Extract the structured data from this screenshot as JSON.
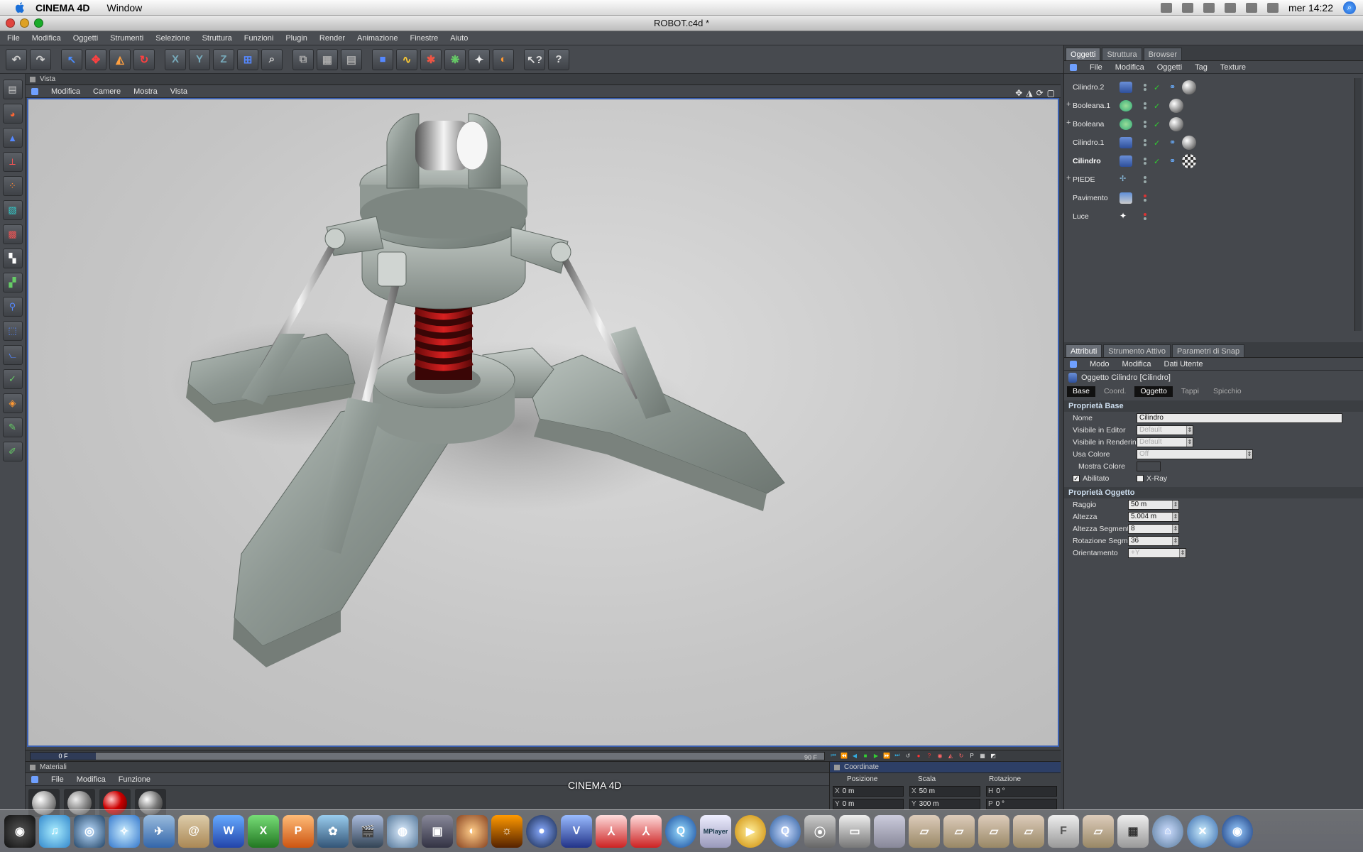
{
  "menubar": {
    "app": "CINEMA 4D",
    "items": [
      "Window"
    ],
    "clock": "mer 14:22"
  },
  "window": {
    "title": "ROBOT.c4d *"
  },
  "appmenu": [
    "File",
    "Modifica",
    "Oggetti",
    "Strumenti",
    "Selezione",
    "Struttura",
    "Funzioni",
    "Plugin",
    "Render",
    "Animazione",
    "Finestre",
    "Aiuto"
  ],
  "viewport": {
    "panel_title": "Vista",
    "menu": [
      "Modifica",
      "Camere",
      "Mostra",
      "Vista"
    ]
  },
  "timeline": {
    "current": "0 F",
    "end": "90 F"
  },
  "materials": {
    "panel_title": "Materiali",
    "menu": [
      "File",
      "Modifica",
      "Funzione"
    ]
  },
  "coords": {
    "panel_title": "Coordinate",
    "cols": [
      "Posizione",
      "Scala",
      "Rotazione"
    ],
    "row1": {
      "x": "0 m",
      "sx": "50 m",
      "h": "0 °",
      "xl": "X",
      "sxl": "X",
      "hl": "H"
    },
    "row2": {
      "y": "0 m",
      "sy": "300 m",
      "p": "0 °",
      "yl": "Y",
      "syl": "Y",
      "pl": "P"
    }
  },
  "objects": {
    "tabs": [
      "Oggetti",
      "Struttura",
      "Browser"
    ],
    "menu": [
      "File",
      "Modifica",
      "Oggetti",
      "Tag",
      "Texture"
    ],
    "items": [
      {
        "name": "Cilindro.2"
      },
      {
        "name": "Booleana.1"
      },
      {
        "name": "Booleana"
      },
      {
        "name": "Cilindro.1"
      },
      {
        "name": "Cilindro"
      },
      {
        "name": "PIEDE"
      },
      {
        "name": "Pavimento"
      },
      {
        "name": "Luce"
      }
    ]
  },
  "attributes": {
    "tabs": [
      "Attributi",
      "Strumento Attivo",
      "Parametri di Snap"
    ],
    "menu": [
      "Modo",
      "Modifica",
      "Dati Utente"
    ],
    "object_title": "Oggetto Cilindro [Cilindro]",
    "subtabs": [
      "Base",
      "Coord.",
      "Oggetto",
      "Tappi",
      "Spicchio"
    ],
    "base_section": "Proprietà Base",
    "name_label": "Nome",
    "name_value": "Cilindro",
    "vis_editor_label": "Visibile in Editor",
    "vis_editor_value": "Default",
    "vis_render_label": "Visibile in Rendering",
    "vis_render_value": "Default",
    "use_color_label": "Usa Colore",
    "use_color_value": "Off",
    "show_color_label": "Mostra Colore",
    "enabled_label": "Abilitato",
    "xray_label": "X-Ray",
    "object_section": "Proprietà Oggetto",
    "radius_label": "Raggio",
    "radius_value": "50 m",
    "height_label": "Altezza",
    "height_value": "5.004 m",
    "hseg_label": "Altezza Segmenti",
    "hseg_value": "8",
    "rseg_label": "Rotazione Segmenti",
    "rseg_value": "36",
    "orient_label": "Orientamento",
    "orient_value": "+Y"
  },
  "dock": {
    "label": "CINEMA 4D"
  }
}
